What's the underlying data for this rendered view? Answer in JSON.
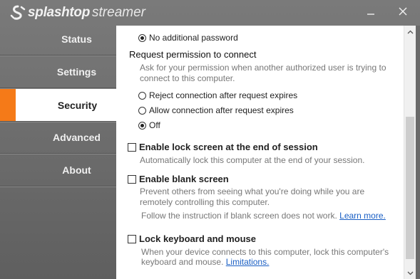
{
  "app": {
    "brand": "splashtop",
    "product": "streamer"
  },
  "window_controls": {
    "minimize_icon": "minimize-icon",
    "close_icon": "close-icon"
  },
  "nav": {
    "items": [
      {
        "label": "Status",
        "active": false
      },
      {
        "label": "Settings",
        "active": false
      },
      {
        "label": "Security",
        "active": true
      },
      {
        "label": "Advanced",
        "active": false
      },
      {
        "label": "About",
        "active": false
      }
    ]
  },
  "accent_color": "#f57a18",
  "security": {
    "password_option": {
      "label": "No additional password",
      "selected": true
    },
    "request_permission": {
      "title": "Request permission to connect",
      "description_line1": "Ask for your permission when another authorized user is trying to",
      "description_line2": "connect to this computer.",
      "options": [
        {
          "label": "Reject connection after request expires",
          "selected": false
        },
        {
          "label": "Allow connection after request expires",
          "selected": false
        },
        {
          "label": "Off",
          "selected": true
        }
      ]
    },
    "lock_screen": {
      "label": "Enable lock screen at the end of session",
      "checked": false,
      "description": "Automatically lock this computer at the end of your session."
    },
    "blank_screen": {
      "label": "Enable blank screen",
      "checked": false,
      "description_line1": "Prevent others from seeing what you're doing while you are",
      "description_line2": "remotely controlling this computer.",
      "note": "Follow the instruction if blank screen does not work.",
      "link": "Learn more."
    },
    "lock_keyboard": {
      "label": "Lock keyboard and mouse",
      "checked": false,
      "description_line1": "When your device connects to this computer, lock this computer's",
      "description_line2_prefix": "keyboard and mouse.",
      "link": "Limitations."
    }
  }
}
